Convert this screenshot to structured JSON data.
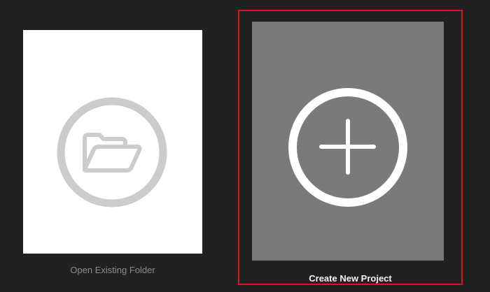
{
  "cards": {
    "open_folder": {
      "label": "Open Existing Folder",
      "icon": "folder-open-icon",
      "card_color": "#ffffff",
      "icon_color": "#cccccc",
      "label_color": "#8c8c8c"
    },
    "create_project": {
      "label": "Create New Project",
      "icon": "plus-circle-icon",
      "card_color": "#7a7a7a",
      "icon_color": "#ffffff",
      "label_color": "#f2f2f2",
      "selected": true,
      "highlight_color": "#e0141e"
    }
  },
  "background_color": "#212121"
}
